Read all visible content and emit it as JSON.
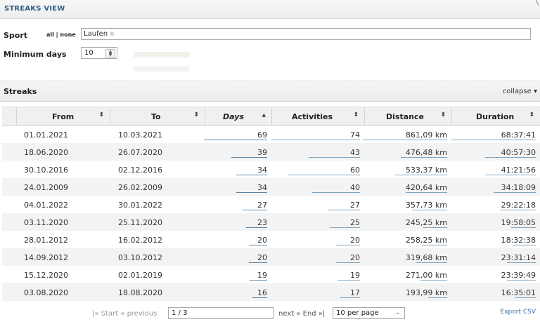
{
  "title": "STREAKS VIEW",
  "filters": {
    "sport_label": "Sport",
    "all_none": "all | none",
    "sport_tag": "Laufen",
    "tag_remove": "×",
    "min_days_label": "Minimum days",
    "min_days_value": "10"
  },
  "section": {
    "title": "Streaks",
    "collapse_label": "collapse ▾"
  },
  "table": {
    "headers": {
      "from": "From",
      "to": "To",
      "days": "Days",
      "activities": "Activities",
      "distance": "Distance",
      "duration": "Duration"
    },
    "sort_icon": "⬍",
    "sort_active_icon": "▲",
    "rows": [
      {
        "from": "01.01.2021",
        "to": "10.03.2021",
        "days": "69",
        "activities": "74",
        "distance": "861,09 km",
        "duration": "68:37:41"
      },
      {
        "from": "18.06.2020",
        "to": "26.07.2020",
        "days": "39",
        "activities": "43",
        "distance": "476,48 km",
        "duration": "40:57:30"
      },
      {
        "from": "30.10.2016",
        "to": "02.12.2016",
        "days": "34",
        "activities": "60",
        "distance": "533,37 km",
        "duration": "41:21:56"
      },
      {
        "from": "24.01.2009",
        "to": "26.02.2009",
        "days": "34",
        "activities": "40",
        "distance": "420,64 km",
        "duration": "34:18:09"
      },
      {
        "from": "04.01.2022",
        "to": "30.01.2022",
        "days": "27",
        "activities": "27",
        "distance": "357,73 km",
        "duration": "29:22:18"
      },
      {
        "from": "03.11.2020",
        "to": "25.11.2020",
        "days": "23",
        "activities": "25",
        "distance": "245,25 km",
        "duration": "19:58:05"
      },
      {
        "from": "28.01.2012",
        "to": "16.02.2012",
        "days": "20",
        "activities": "20",
        "distance": "258,25 km",
        "duration": "18:32:38"
      },
      {
        "from": "14.09.2012",
        "to": "03.10.2012",
        "days": "20",
        "activities": "20",
        "distance": "319,68 km",
        "duration": "23:31:14"
      },
      {
        "from": "15.12.2020",
        "to": "02.01.2019",
        "days": "19",
        "activities": "19",
        "distance": "271,00 km",
        "duration": "23:39:49"
      },
      {
        "from": "03.08.2020",
        "to": "18.08.2020",
        "days": "16",
        "activities": "17",
        "distance": "193,99 km",
        "duration": "16:35:01"
      }
    ]
  },
  "pager": {
    "prev": "|« Start « previous",
    "page_value": "1 / 3",
    "next": "next » End »|",
    "per_page": "10 per page",
    "export": "Export CSV"
  }
}
